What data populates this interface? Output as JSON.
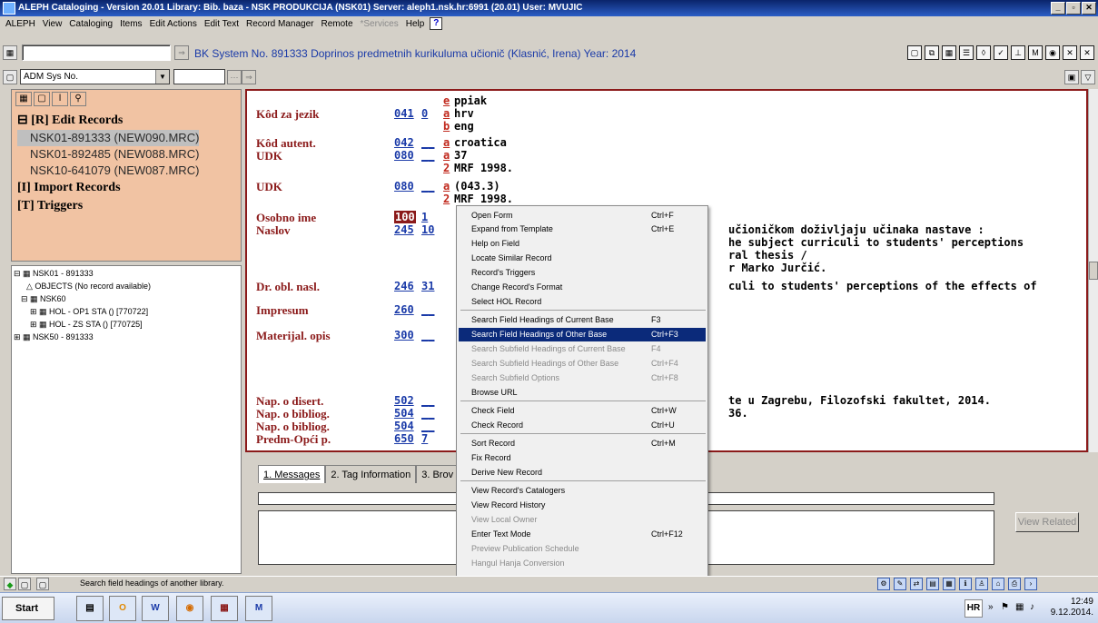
{
  "window": {
    "title": "ALEPH Cataloging - Version 20.01  Library:  Bib. baza - NSK PRODUKCIJA (NSK01)  Server:  aleph1.nsk.hr:6991 (20.01)  User:  MVUJIC",
    "min": "_",
    "max": "▫",
    "close": "✕"
  },
  "menubar": {
    "items": [
      "ALEPH",
      "View",
      "Cataloging",
      "Items",
      "Edit Actions",
      "Edit Text",
      "Record Manager",
      "Remote"
    ],
    "disabled_item": "*Services",
    "help": "Help",
    "help_q": "?"
  },
  "toolbar": {
    "record_banner": "BK System No. 891333 Doprinos predmetnih kurikuluma učionič (Klasnić, Irena) Year: 2014",
    "search_select": "ADM Sys No."
  },
  "tree": {
    "edit_header": "[R] Edit Records",
    "edit_items": [
      "NSK01-891333 (NEW090.MRC)",
      "NSK01-892485 (NEW088.MRC)",
      "NSK10-641079 (NEW087.MRC)"
    ],
    "import_header": "[I] Import Records",
    "triggers_header": "[T] Triggers",
    "nodes": [
      "NSK01 - 891333",
      "OBJECTS (No record available)",
      "NSK60",
      "HOL - OP1 STA () [770722]",
      "HOL - ZS STA () [770725]",
      "NSK50 - 891333"
    ]
  },
  "editor": {
    "rows": [
      {
        "label": "",
        "tag": "",
        "ind": "",
        "sf": "e",
        "value": "ppiak",
        "value2": ""
      },
      {
        "label": "Kôd za jezik",
        "tag": "041",
        "ind": "0",
        "sf": "a",
        "value": "hrv",
        "value2": ""
      },
      {
        "label": "",
        "tag": "",
        "ind": "",
        "sf": "b",
        "value": "eng",
        "value2": ""
      },
      {
        "label": "Kôd autent.",
        "tag": "042",
        "ind": "__",
        "sf": "a",
        "value": "croatica",
        "value2": ""
      },
      {
        "label": "UDK",
        "tag": "080",
        "ind": "__",
        "sf": "a",
        "value": "37",
        "value2": ""
      },
      {
        "label": "",
        "tag": "",
        "ind": "",
        "sf": "2",
        "value": "MRF 1998.",
        "value2": ""
      },
      {
        "label": "UDK",
        "tag": "080",
        "ind": "__",
        "sf": "a",
        "value": "(043.3)",
        "value2": ""
      },
      {
        "label": "",
        "tag": "",
        "ind": "",
        "sf": "2",
        "value": "MRF 1998.",
        "value2": ""
      },
      {
        "label": "Osobno ime",
        "tag": "100",
        "ind": "1",
        "sf": "",
        "value": "",
        "value2": ""
      },
      {
        "label": "Naslov",
        "tag": "245",
        "ind": "10",
        "sf": "",
        "value": "",
        "value2": "učioničkom doživljaju učinaka nastave :"
      },
      {
        "label": "",
        "tag": "",
        "ind": "",
        "sf": "",
        "value": "",
        "value2": "he subject curriculi to students' perceptions"
      },
      {
        "label": "",
        "tag": "",
        "ind": "",
        "sf": "",
        "value": "",
        "value2": "ral thesis /"
      },
      {
        "label": "",
        "tag": "",
        "ind": "",
        "sf": "",
        "value": "",
        "value2": "r Marko Jurčić."
      },
      {
        "label": "Dr. obl. nasl.",
        "tag": "246",
        "ind": "31",
        "sf": "",
        "value": "",
        "value2": "culi to students' perceptions of the effects of"
      },
      {
        "label": "Impresum",
        "tag": "260",
        "ind": "__",
        "sf": "",
        "value": "",
        "value2": ""
      },
      {
        "label": "Materijal. opis",
        "tag": "300",
        "ind": "__",
        "sf": "",
        "value": "",
        "value2": ""
      },
      {
        "label": "Nap. o disert.",
        "tag": "502",
        "ind": "__",
        "sf": "",
        "value": "",
        "value2": "te u Zagrebu, Filozofski fakultet, 2014."
      },
      {
        "label": "Nap. o bibliog.",
        "tag": "504",
        "ind": "__",
        "sf": "",
        "value": "",
        "value2": "36."
      },
      {
        "label": "Nap. o bibliog.",
        "tag": "504",
        "ind": "__",
        "sf": "",
        "value": "",
        "value2": ""
      },
      {
        "label": "Predm-Opći p.",
        "tag": "650",
        "ind": "7",
        "sf": "",
        "value": "",
        "value2": ""
      }
    ]
  },
  "tabs": [
    "1. Messages",
    "2. Tag Information",
    "3. Brov"
  ],
  "view_related": "View Related",
  "context_menu": {
    "items": [
      {
        "label": "Open Form",
        "sc": "Ctrl+F",
        "state": ""
      },
      {
        "label": "Expand from Template",
        "sc": "Ctrl+E",
        "state": ""
      },
      {
        "label": "Help on Field",
        "sc": "",
        "state": ""
      },
      {
        "label": "Locate Similar Record",
        "sc": "",
        "state": ""
      },
      {
        "label": "Record's Triggers",
        "sc": "",
        "state": ""
      },
      {
        "label": "Change Record's Format",
        "sc": "",
        "state": ""
      },
      {
        "label": "Select HOL Record",
        "sc": "",
        "state": ""
      },
      {
        "label": "Search Field Headings of Current Base",
        "sc": "F3",
        "state": ""
      },
      {
        "label": "Search Field Headings of Other Base",
        "sc": "Ctrl+F3",
        "state": "sel"
      },
      {
        "label": "Search Subfield Headings of Current Base",
        "sc": "F4",
        "state": "dis"
      },
      {
        "label": "Search Subfield Headings of Other Base",
        "sc": "Ctrl+F4",
        "state": "dis"
      },
      {
        "label": "Search Subfield Options",
        "sc": "Ctrl+F8",
        "state": "dis"
      },
      {
        "label": "Browse URL",
        "sc": "",
        "state": ""
      },
      {
        "label": "Check Field",
        "sc": "Ctrl+W",
        "state": ""
      },
      {
        "label": "Check Record",
        "sc": "Ctrl+U",
        "state": ""
      },
      {
        "label": "Sort Record",
        "sc": "Ctrl+M",
        "state": ""
      },
      {
        "label": "Fix Record",
        "sc": "",
        "state": ""
      },
      {
        "label": "Derive New Record",
        "sc": "",
        "state": ""
      },
      {
        "label": "View Record's Catalogers",
        "sc": "",
        "state": ""
      },
      {
        "label": "View Record History",
        "sc": "",
        "state": ""
      },
      {
        "label": "View Local Owner",
        "sc": "",
        "state": "dis"
      },
      {
        "label": "Enter Text Mode",
        "sc": "Ctrl+F12",
        "state": ""
      },
      {
        "label": "Preview Publication Schedule",
        "sc": "",
        "state": "dis"
      },
      {
        "label": "Hangul Hanja Conversion",
        "sc": "",
        "state": "dis"
      }
    ]
  },
  "status": {
    "text": "Search field headings of another library."
  },
  "taskbar": {
    "start": "Start",
    "lang": "HR",
    "time": "12:49",
    "date": "9.12.2014."
  }
}
